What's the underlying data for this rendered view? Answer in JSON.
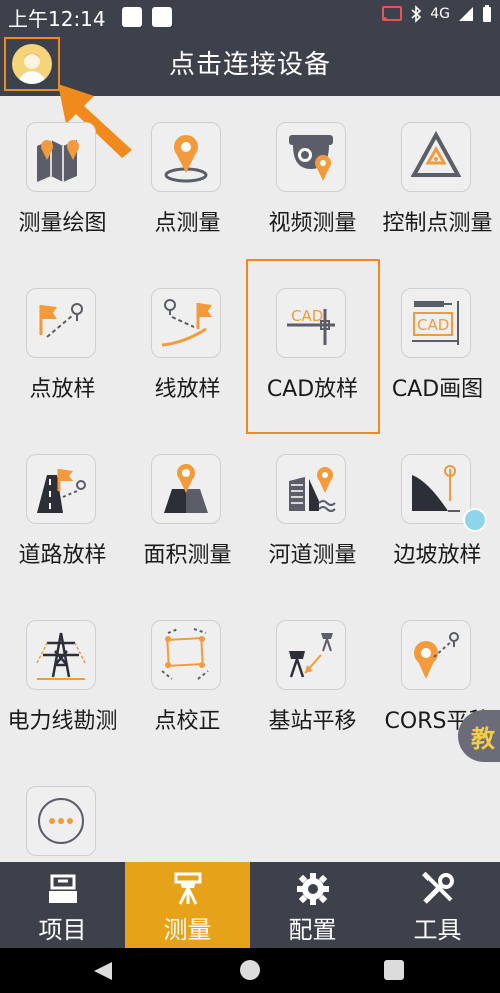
{
  "status_bar": {
    "time": "上午12:14",
    "network": "4G"
  },
  "header": {
    "title": "点击连接设备"
  },
  "grid": {
    "items": [
      {
        "label": "测量绘图",
        "icon": "map-survey-icon"
      },
      {
        "label": "点测量",
        "icon": "point-measure-icon"
      },
      {
        "label": "视频测量",
        "icon": "video-measure-icon"
      },
      {
        "label": "控制点测量",
        "icon": "control-point-icon"
      },
      {
        "label": "点放样",
        "icon": "point-stakeout-icon"
      },
      {
        "label": "线放样",
        "icon": "line-stakeout-icon"
      },
      {
        "label": "CAD放样",
        "icon": "cad-stakeout-icon"
      },
      {
        "label": "CAD画图",
        "icon": "cad-drawing-icon"
      },
      {
        "label": "道路放样",
        "icon": "road-stakeout-icon"
      },
      {
        "label": "面积测量",
        "icon": "area-measure-icon"
      },
      {
        "label": "河道测量",
        "icon": "river-measure-icon"
      },
      {
        "label": "边坡放样",
        "icon": "slope-stakeout-icon"
      },
      {
        "label": "电力线勘测",
        "icon": "power-line-icon"
      },
      {
        "label": "点校正",
        "icon": "point-calibration-icon"
      },
      {
        "label": "基站平移",
        "icon": "base-station-icon"
      },
      {
        "label": "CORS平移",
        "icon": "cors-shift-icon"
      },
      {
        "label": "",
        "icon": "more-icon"
      }
    ],
    "cad_tile_text": "CAD"
  },
  "floating_tab": {
    "label": "教"
  },
  "bottom_nav": {
    "items": [
      {
        "label": "项目",
        "icon": "project-icon"
      },
      {
        "label": "测量",
        "icon": "survey-icon",
        "active": true
      },
      {
        "label": "配置",
        "icon": "settings-icon"
      },
      {
        "label": "工具",
        "icon": "tools-icon"
      }
    ]
  },
  "colors": {
    "dark_bar": "#3d414b",
    "accent_orange": "#f08a1c",
    "active_nav": "#e6a31a"
  }
}
